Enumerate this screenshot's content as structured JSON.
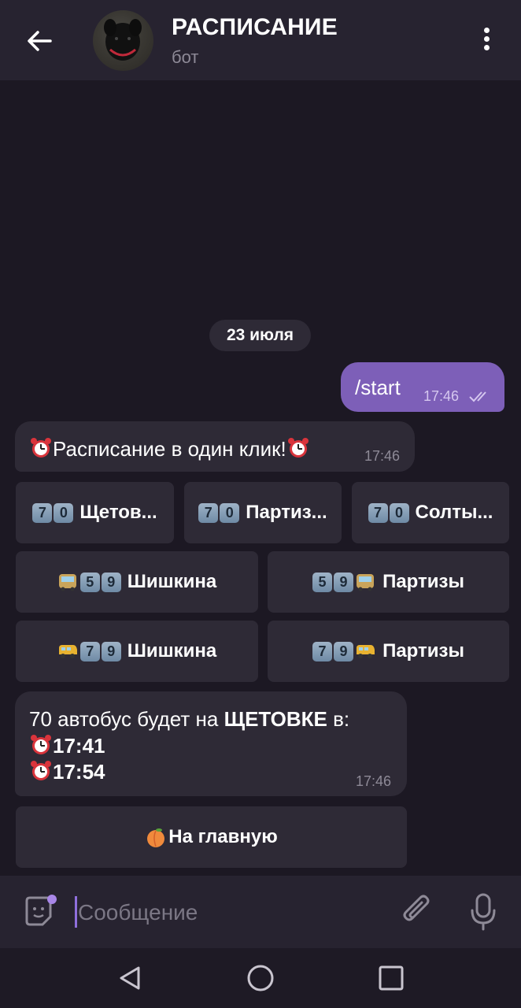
{
  "header": {
    "title": "РАСПИСАНИЕ",
    "subtitle": "бот"
  },
  "date_chip": "23 июля",
  "messages": [
    {
      "from": "me",
      "text": "/start",
      "time": "17:46"
    },
    {
      "from": "bot",
      "text": "Расписание в один клик!",
      "time": "17:46"
    },
    {
      "from": "bot",
      "line1_prefix": "70 автобус будет на ",
      "line1_bold": "ЩЕТОВКЕ",
      "line1_suffix": " в:",
      "times": [
        "17:41",
        "17:54"
      ],
      "time": "17:46"
    }
  ],
  "keyboard_rows": [
    [
      {
        "keycaps": [
          "7",
          "0"
        ],
        "label": "Щетов..."
      },
      {
        "keycaps": [
          "7",
          "0"
        ],
        "label": "Партиз..."
      },
      {
        "keycaps": [
          "7",
          "0"
        ],
        "label": "Солты..."
      }
    ],
    [
      {
        "keycaps": [
          "5",
          "9"
        ],
        "label": "Шишкина",
        "icon": "bus-front-icon"
      },
      {
        "keycaps": [
          "5",
          "9"
        ],
        "label": "Партизы",
        "icon": "bus-front-icon"
      }
    ],
    [
      {
        "keycaps": [
          "7",
          "9"
        ],
        "label": "Шишкина",
        "icon": "minibus-icon"
      },
      {
        "keycaps": [
          "7",
          "9"
        ],
        "label": "Партизы",
        "icon": "minibus-icon"
      }
    ]
  ],
  "home_button": {
    "label": "На главную",
    "icon": "peach-icon"
  },
  "input": {
    "placeholder": "Сообщение"
  },
  "colors": {
    "background": "#1c1823",
    "header": "#272330",
    "bubble_in": "#2e2a36",
    "bubble_out": "#7d5fb8",
    "accent": "#8f6fdc"
  }
}
